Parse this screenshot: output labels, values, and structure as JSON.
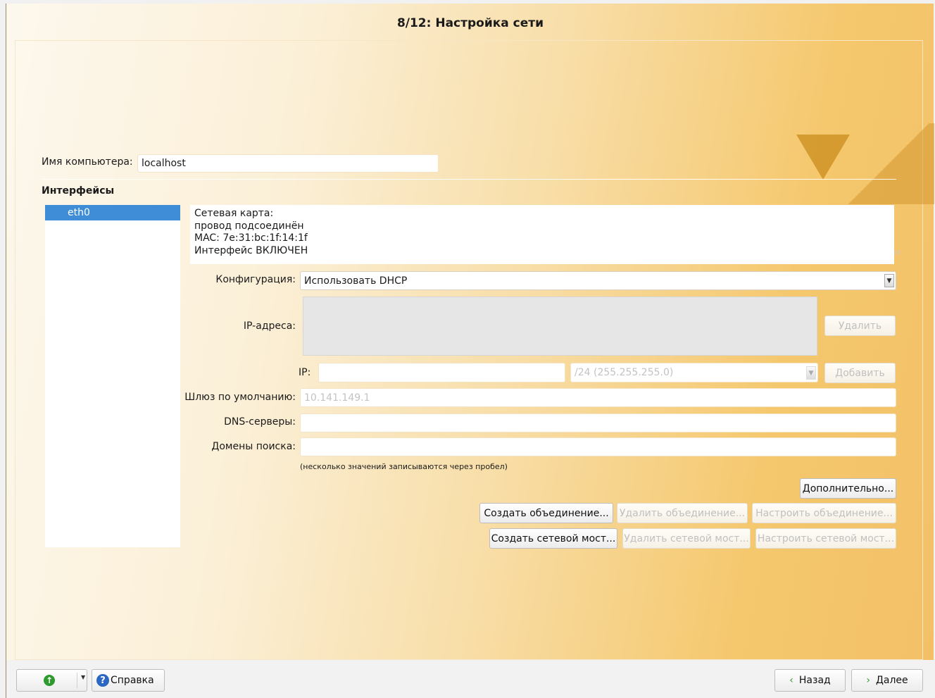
{
  "window": {
    "title": "8/12: Настройка сети"
  },
  "hostname": {
    "label": "Имя компьютера:",
    "value": "localhost"
  },
  "interfaces": {
    "heading": "Интерфейсы",
    "items": [
      "eth0"
    ],
    "info_lines": [
      "Сетевая карта:",
      "провод подсоединён",
      "MAC: 7e:31:bc:1f:14:1f",
      "Интерфейс ВКЛЮЧЕН"
    ]
  },
  "config": {
    "label": "Конфигурация:",
    "value": "Использовать DHCP",
    "ip_list_label": "IP-адреса:",
    "delete_label": "Удалить",
    "ip_label": "IP:",
    "ip_value": "",
    "mask_value": "/24 (255.255.255.0)",
    "add_label": "Добавить",
    "gateway_label": "Шлюз по умолчанию:",
    "gateway_value": "10.141.149.1",
    "dns_label": "DNS-серверы:",
    "dns_value": "",
    "domains_label": "Домены поиска:",
    "domains_value": "",
    "hint": "(несколько значений записываются через пробел)"
  },
  "actions": {
    "advanced": "Дополнительно...",
    "create_bond": "Создать объединение...",
    "delete_bond": "Удалить объединение...",
    "configure_bond": "Настроить объединение...",
    "create_bridge": "Создать сетевой мост...",
    "delete_bridge": "Удалить сетевой мост...",
    "configure_bridge": "Настроить сетевой мост..."
  },
  "footer": {
    "help": "Справка",
    "back": "Назад",
    "next": "Далее"
  },
  "colors": {
    "accent": "#3e8dd6",
    "background": "#f5c86e"
  }
}
